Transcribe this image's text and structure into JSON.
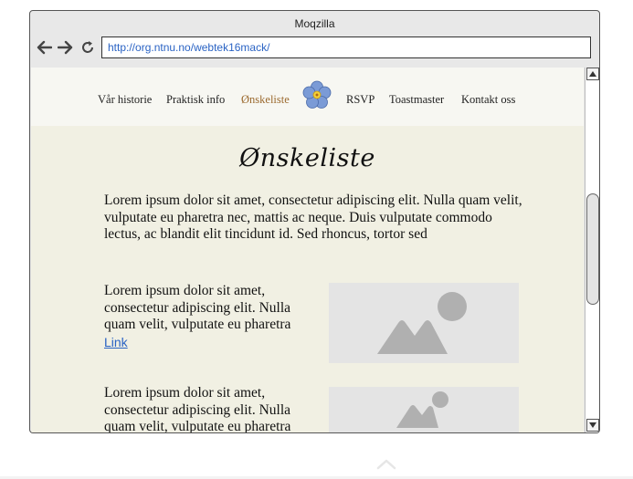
{
  "window": {
    "title": "Moqzilla"
  },
  "toolbar": {
    "back_icon": "back-arrow-icon",
    "forward_icon": "forward-arrow-icon",
    "reload_icon": "reload-icon",
    "url": "http://org.ntnu.no/webtek16mack/"
  },
  "site": {
    "nav": [
      {
        "label": "Vår historie",
        "active": false
      },
      {
        "label": "Praktisk info",
        "active": false
      },
      {
        "label": "Ønskeliste",
        "active": true
      },
      {
        "label": "RSVP",
        "active": false
      },
      {
        "label": "Toastmaster",
        "active": false
      },
      {
        "label": "Kontakt oss",
        "active": false
      }
    ],
    "logo_icon": "forget-me-not-flower-icon",
    "heading": "Ønskeliste",
    "intro": "Lorem ipsum dolor sit amet, consectetur adipiscing elit. Nulla quam velit, vulputate eu pharetra nec, mattis ac neque. Duis vulputate commodo lectus, ac blandit elit tincidunt id. Sed rhoncus, tortor sed",
    "items": [
      {
        "text": "Lorem ipsum dolor sit amet, consectetur adipiscing elit. Nulla quam velit, vulputate eu pharetra",
        "link": "Link"
      },
      {
        "text": "Lorem ipsum dolor sit amet, consectetur adipiscing elit. Nulla quam velit, vulputate eu pharetra"
      }
    ]
  },
  "colors": {
    "page_bg": "#f1f0e3",
    "nav_bg": "#f7f7f2",
    "active_nav": "#9b6a2f",
    "link": "#2a63c4",
    "placeholder": "#e4e4e4"
  }
}
